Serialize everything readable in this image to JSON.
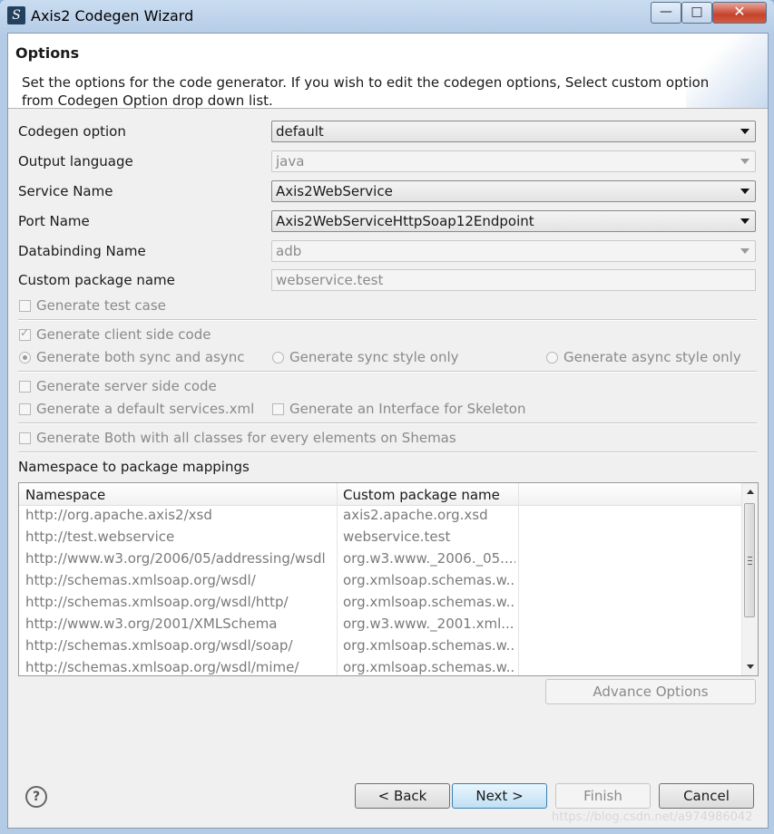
{
  "window": {
    "title": "Axis2 Codegen Wizard",
    "app_icon_glyph": "S"
  },
  "header": {
    "title": "Options",
    "description_line1": "Set the options for the code generator. If you wish to edit the codegen options, Select custom option",
    "description_line2": "from Codegen Option drop down list."
  },
  "fields": {
    "codegen_option": {
      "label": "Codegen option",
      "value": "default"
    },
    "output_language": {
      "label": "Output language",
      "value": "java"
    },
    "service_name": {
      "label": "Service Name",
      "value": "Axis2WebService"
    },
    "port_name": {
      "label": "Port Name",
      "value": "Axis2WebServiceHttpSoap12Endpoint"
    },
    "databinding_name": {
      "label": "Databinding Name",
      "value": "adb"
    },
    "custom_package": {
      "label": "Custom package name",
      "value": "webservice.test"
    }
  },
  "options": {
    "generate_test_case": "Generate test case",
    "generate_client_side": "Generate client side code",
    "both_sync_async": "Generate both sync and async",
    "sync_only": "Generate sync style only",
    "async_only": "Generate async style only",
    "generate_server_side": "Generate server side code",
    "default_services_xml": "Generate a default services.xml",
    "interface_skeleton": "Generate an Interface for Skeleton",
    "generate_both_all": "Generate Both with all classes for every elements on Shemas"
  },
  "mappings": {
    "label": "Namespace to package mappings",
    "columns": [
      "Namespace",
      "Custom package name"
    ],
    "rows": [
      {
        "namespace": "http://org.apache.axis2/xsd",
        "package": "axis2.apache.org.xsd"
      },
      {
        "namespace": "http://test.webservice",
        "package": "webservice.test"
      },
      {
        "namespace": "http://www.w3.org/2006/05/addressing/wsdl",
        "package": "org.w3.www._2006._05...."
      },
      {
        "namespace": "http://schemas.xmlsoap.org/wsdl/",
        "package": "org.xmlsoap.schemas.w..."
      },
      {
        "namespace": "http://schemas.xmlsoap.org/wsdl/http/",
        "package": "org.xmlsoap.schemas.w..."
      },
      {
        "namespace": "http://www.w3.org/2001/XMLSchema",
        "package": "org.w3.www._2001.xml..."
      },
      {
        "namespace": "http://schemas.xmlsoap.org/wsdl/soap/",
        "package": "org.xmlsoap.schemas.w..."
      },
      {
        "namespace": "http://schemas.xmlsoap.org/wsdl/mime/",
        "package": "org.xmlsoap.schemas.w..."
      }
    ]
  },
  "buttons": {
    "advance_options": "Advance Options",
    "back": "< Back",
    "next": "Next >",
    "finish": "Finish",
    "cancel": "Cancel",
    "help": "?"
  },
  "window_buttons": {
    "minimize": "—",
    "maximize": "□",
    "close": "✕"
  },
  "watermark": "https://blog.csdn.net/a974986042",
  "colors": {
    "disabled_text": "#8a8a8a",
    "default_button_border": "#3c7fb1",
    "close_button": "#c6432c"
  }
}
